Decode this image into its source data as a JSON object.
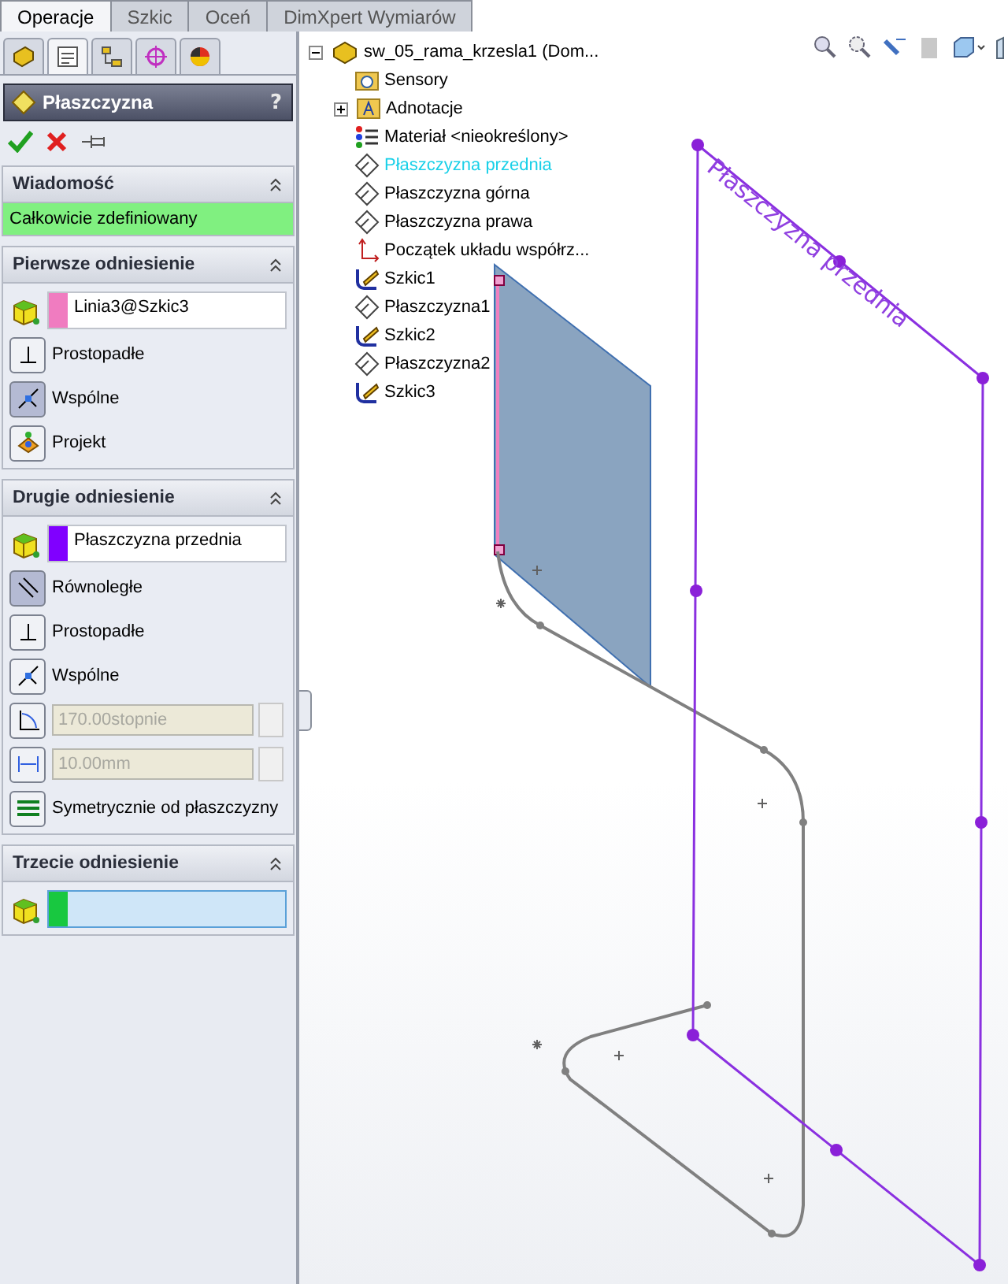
{
  "command_tabs": [
    {
      "label": "Operacje",
      "selected": true
    },
    {
      "label": "Szkic",
      "selected": false
    },
    {
      "label": "Oceń",
      "selected": false
    },
    {
      "label": "DimXpert Wymiarów",
      "selected": false
    }
  ],
  "panel_tabs": [
    {
      "selected": false
    },
    {
      "selected": true
    },
    {
      "selected": false
    },
    {
      "selected": false
    },
    {
      "selected": false
    }
  ],
  "property_manager": {
    "title": "Płaszczyzna",
    "help": "?"
  },
  "sections": [
    {
      "kind": "message",
      "title": "Wiadomość",
      "message": "Całkowicie zdefiniowany"
    },
    {
      "kind": "reference",
      "title": "Pierwsze odniesienie",
      "selection": {
        "value": "Linia3@Szkic3",
        "color": "#f07cc0",
        "active": false
      },
      "options": [
        {
          "kind": "perpendicular",
          "label": "Prostopadłe",
          "selected": false
        },
        {
          "kind": "coincident",
          "label": "Wspólne",
          "selected": true
        },
        {
          "kind": "project",
          "label": "Projekt",
          "selected": false
        }
      ]
    },
    {
      "kind": "reference",
      "title": "Drugie odniesienie",
      "selection": {
        "value": "Płaszczyzna przednia",
        "color": "#8000ff",
        "active": false
      },
      "options": [
        {
          "kind": "parallel",
          "label": "Równoległe",
          "selected": true
        },
        {
          "kind": "perpendicular",
          "label": "Prostopadłe",
          "selected": false
        },
        {
          "kind": "coincident",
          "label": "Wspólne",
          "selected": false
        },
        {
          "kind": "angle",
          "value": "170.00stopnie",
          "disabled": true
        },
        {
          "kind": "distance",
          "value": "10.00mm",
          "disabled": true
        },
        {
          "kind": "symmetric",
          "label": "Symetrycznie od płaszczyzny",
          "selected": false
        }
      ]
    },
    {
      "kind": "reference",
      "title": "Trzecie odniesienie",
      "selection": {
        "color": "#18c840",
        "active": true
      }
    }
  ],
  "tree": {
    "root": {
      "label": "sw_05_rama_krzesla1  (Dom...",
      "expanded": true
    },
    "items": [
      {
        "kind": "sensors",
        "label": "Sensory",
        "highlighted": false
      },
      {
        "kind": "annotations",
        "label": "Adnotacje",
        "highlighted": false,
        "expanded": false
      },
      {
        "kind": "material",
        "label": "Materiał <nieokreślony>",
        "highlighted": false
      },
      {
        "kind": "plane",
        "label": "Płaszczyzna przednia",
        "highlighted": true
      },
      {
        "kind": "plane",
        "label": "Płaszczyzna górna",
        "highlighted": false
      },
      {
        "kind": "plane",
        "label": "Płaszczyzna prawa",
        "highlighted": false
      },
      {
        "kind": "origin",
        "label": "Początek układu współrz...",
        "highlighted": false
      },
      {
        "kind": "sketch",
        "label": "Szkic1",
        "highlighted": false
      },
      {
        "kind": "plane",
        "label": "Płaszczyzna1",
        "highlighted": false
      },
      {
        "kind": "sketch",
        "label": "Szkic2",
        "highlighted": false
      },
      {
        "kind": "plane",
        "label": "Płaszczyzna2",
        "highlighted": false
      },
      {
        "kind": "sketch",
        "label": "Szkic3",
        "highlighted": false
      }
    ]
  },
  "viewport": {
    "plane_label": "Płaszczyzna przednia"
  }
}
